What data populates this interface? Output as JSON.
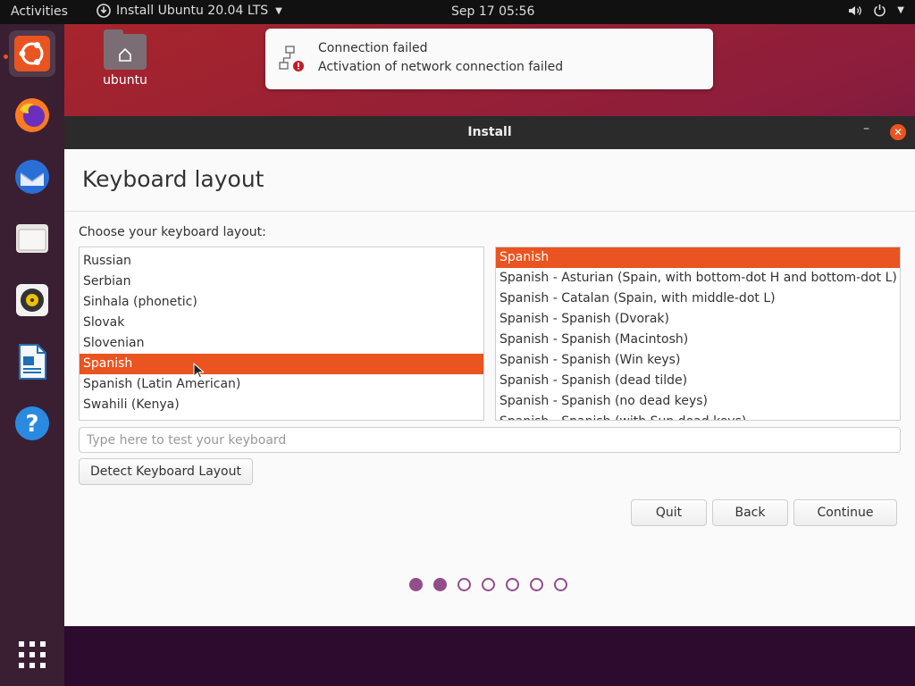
{
  "topbar": {
    "activities": "Activities",
    "app_title": "Install Ubuntu 20.04 LTS",
    "clock": "Sep 17  05:56"
  },
  "desktop": {
    "home_icon_label": "ubuntu"
  },
  "notification": {
    "title": "Connection failed",
    "body": "Activation of network connection failed"
  },
  "window": {
    "title": "Install",
    "heading": "Keyboard layout",
    "choose_label": "Choose your keyboard layout:",
    "layouts": [
      "Russian",
      "Serbian",
      "Sinhala (phonetic)",
      "Slovak",
      "Slovenian",
      "Spanish",
      "Spanish (Latin American)",
      "Swahili (Kenya)"
    ],
    "selected_layout_index": 5,
    "variants": [
      "Spanish",
      "Spanish - Asturian (Spain, with bottom-dot H and bottom-dot L)",
      "Spanish - Catalan (Spain, with middle-dot L)",
      "Spanish - Spanish (Dvorak)",
      "Spanish - Spanish (Macintosh)",
      "Spanish - Spanish (Win keys)",
      "Spanish - Spanish (dead tilde)",
      "Spanish - Spanish (no dead keys)",
      "Spanish - Spanish (with Sun dead keys)"
    ],
    "selected_variant_index": 0,
    "test_placeholder": "Type here to test your keyboard",
    "detect_button": "Detect Keyboard Layout",
    "quit_button": "Quit",
    "back_button": "Back",
    "continue_button": "Continue",
    "progress": {
      "total_steps": 7,
      "completed_steps": 2
    }
  },
  "colors": {
    "accent": "#e95420",
    "progress": "#924d8b",
    "topbar": "#111111",
    "dock": "#3a1f33"
  },
  "dock": {
    "items": [
      "ubuntu-installer-icon",
      "firefox-icon",
      "thunderbird-icon",
      "files-icon",
      "rhythmbox-icon",
      "libreoffice-writer-icon",
      "help-icon"
    ],
    "show_apps": "show-applications-icon"
  }
}
